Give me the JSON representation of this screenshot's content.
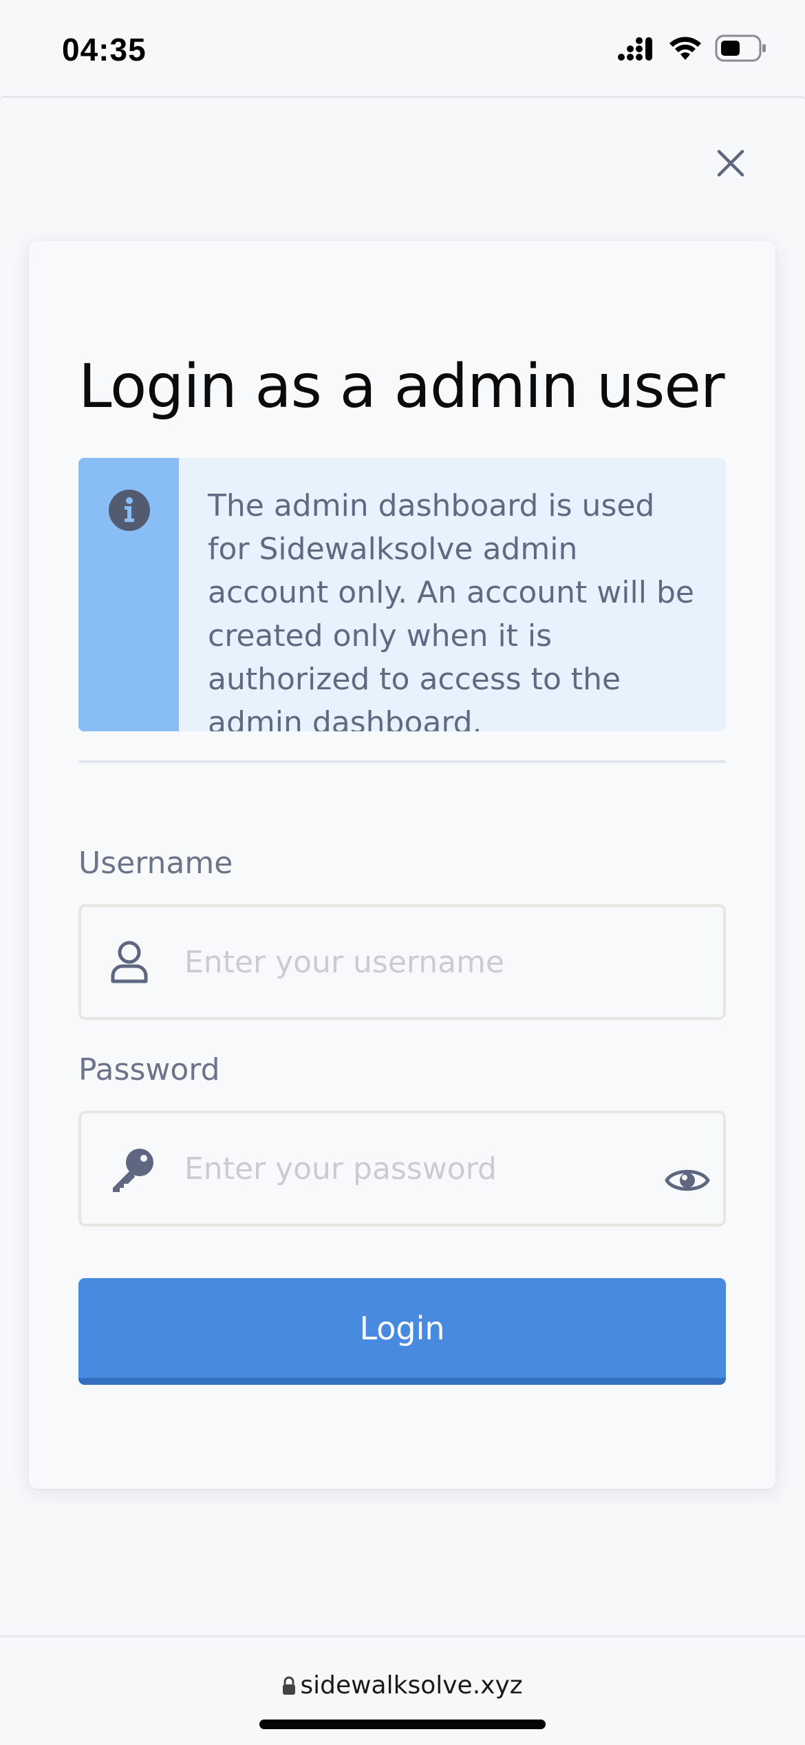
{
  "status_bar": {
    "time": "04:35"
  },
  "dialog": {
    "title": "Login as a admin user",
    "info_text": "The admin dashboard is used for Sidewalksolve admin account only. An account will be created only when it is authorized to access to the admin dashboard.",
    "username": {
      "label": "Username",
      "placeholder": "Enter your username",
      "value": ""
    },
    "password": {
      "label": "Password",
      "placeholder": "Enter your password",
      "value": ""
    },
    "login_label": "Login"
  },
  "browser": {
    "url": "sidewalksolve.xyz"
  },
  "colors": {
    "accent": "#478ae0",
    "info_stripe": "#89bdf5",
    "info_background": "#e8f2fd",
    "icon_gray": "#5e6680"
  },
  "icons": {
    "close": "close-icon",
    "info": "info-icon",
    "user": "user-icon",
    "key": "key-icon",
    "eye": "eye-icon",
    "lock": "lock-icon",
    "signal": "cellular-signal-icon",
    "wifi": "wifi-icon",
    "battery": "battery-icon"
  }
}
